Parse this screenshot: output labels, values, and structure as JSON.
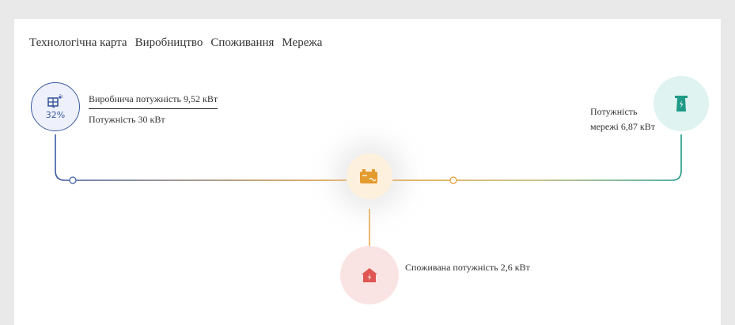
{
  "tabs": [
    "Технологічна карта",
    "Виробництво",
    "Споживання",
    "Мережа"
  ],
  "solar": {
    "percent": "32%",
    "production_label": "Виробнича потужність 9,52 кВт",
    "capacity_label": "Потужність 30 кВт",
    "color": "#3a5aa0"
  },
  "grid": {
    "power_label": "Потужність мережі 6,87 кВт",
    "color": "#1f9a86"
  },
  "battery": {
    "color": "#e49b2e"
  },
  "home": {
    "consumption_label": "Споживана потужність 2,6 кВт",
    "color": "#df5652"
  }
}
